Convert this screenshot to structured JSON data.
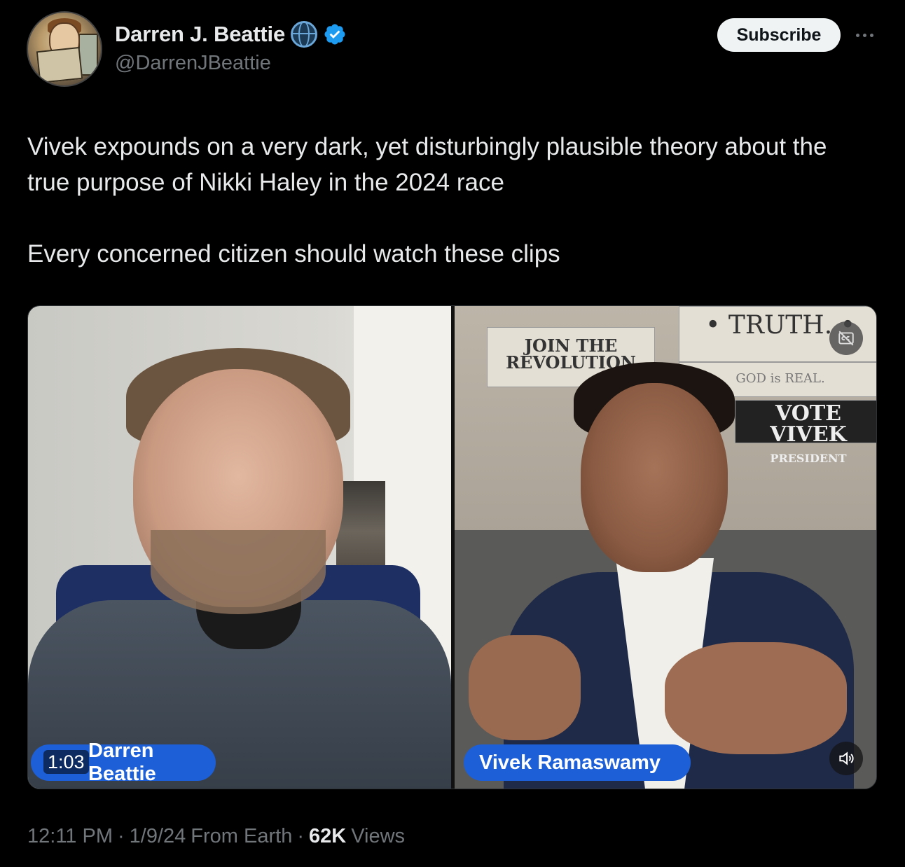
{
  "author": {
    "display_name": "Darren J. Beattie",
    "handle": "@DarrenJBeattie",
    "badge_icon": "globe-icon",
    "verified_icon": "verified-badge-icon",
    "verified_color": "#1d9bf0"
  },
  "header": {
    "subscribe_label": "Subscribe",
    "more_icon": "more-horizontal-icon"
  },
  "tweet": {
    "text": "Vivek expounds on a very dark, yet disturbingly plausible theory about the true purpose of Nikki Haley in the 2024 race\n\nEvery concerned citizen should watch these clips"
  },
  "media": {
    "duration": "1:03",
    "left_name": "Darren Beattie",
    "right_name": "Vivek Ramaswamy",
    "pill_color": "#1d5fd6",
    "signs": {
      "truth": "• TRUTH. •",
      "join": "JOIN THE REVOLUTION",
      "god": "GOD is REAL.",
      "vote": "VOTE VIVEK",
      "president": "PRESIDENT"
    },
    "captions_icon": "captions-off-icon",
    "sound_icon": "volume-icon"
  },
  "footer": {
    "time": "12:11 PM",
    "date": "1/9/24",
    "source": "From Earth",
    "views_count": "62K",
    "views_label": "Views",
    "separator": "·"
  }
}
